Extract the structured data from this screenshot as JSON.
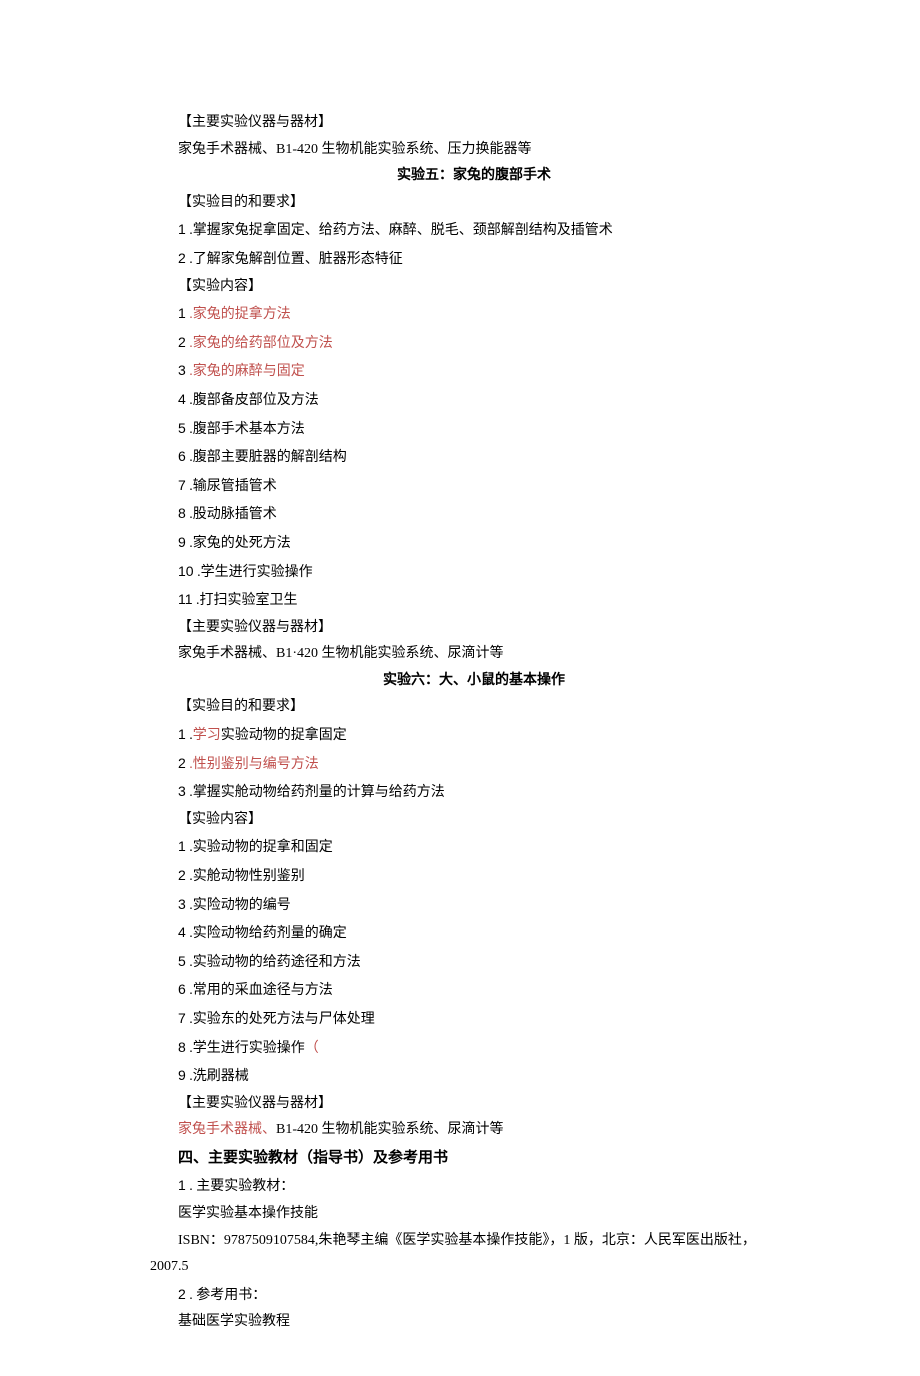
{
  "s0": {
    "h1": "【主要实验仪器与器材】",
    "p1": "家兔手术器械、B1-420 生物机能实验系统、压力换能器等"
  },
  "exp5": {
    "title": "实验五：家兔的腹部手术",
    "aim_h": "【实验目的和要求】",
    "aim1_n": "1",
    "aim1_t": " .掌握家兔捉拿固定、给药方法、麻醉、脱毛、颈部解剖结构及插管术",
    "aim2_n": "2",
    "aim2_t": " .了解家兔解剖位置、脏器形态特征",
    "cont_h": "【实验内容】",
    "c1_n": "1",
    "c1_t": " .家兔的捉拿方法",
    "c2_n": "2",
    "c2_t": "  .家兔的给药部位及方法",
    "c3_n": "3",
    "c3_t": "  .家兔的麻醉与固定",
    "c4_n": "4",
    "c4_t": "  .腹部备皮部位及方法",
    "c5_n": "5",
    "c5_t": "  .腹部手术基本方法",
    "c6_n": "6",
    "c6_t": "  .腹部主要脏器的解剖结构",
    "c7_n": "7",
    "c7_t": "   .输尿管插管术",
    "c8_n": "8",
    "c8_t": "  .股动脉插管术",
    "c9_n": "9",
    "c9_t": "  .家兔的处死方法",
    "c10_n": "10",
    "c10_t": "   .学生进行实验操作",
    "c11_n": "11",
    "c11_t": "  .打扫实验室卫生",
    "inst_h": "【主要实验仪器与器材】",
    "inst_p": "家兔手术器械、B1·420 生物机能实验系统、尿滴计等"
  },
  "exp6": {
    "title": "实验六：大、小鼠的基本操作",
    "aim_h": "【实验目的和要求】",
    "a1_n": "1",
    "a1_pre": " .",
    "a1_red": "学习",
    "a1_rest": "实验动物的捉拿固定",
    "a2_n": "2",
    "a2_t": "  .性别鉴别与编号方法",
    "a3_n": "3",
    "a3_t": "  .掌握实舱动物给药剂量的计算与给药方法",
    "cont_h": "【实验内容】",
    "c1_n": "1",
    "c1_t": "  .实验动物的捉拿和固定",
    "c2_n": "2",
    "c2_t": "  .实舱动物性别鉴别",
    "c3_n": "3",
    "c3_t": "  .实险动物的编号",
    "c4_n": "4",
    "c4_t": "  .实险动物给药剂量的确定",
    "c5_n": "5",
    "c5_t": "  .实验动物的给药途径和方法",
    "c6_n": "6",
    "c6_t": "   .常用的采血途径与方法",
    "c7_n": "7",
    "c7_t": "  .实验东的处死方法与尸体处理",
    "c8_n": "8",
    "c8_t": "  .学生进行实验操作",
    "c8_paren": "（",
    "c9_n": "9",
    "c9_t": "   .洗刷器械",
    "inst_h": "【主要实验仪器与器材】",
    "inst_red": "家兔手术器械、",
    "inst_rest": "B1-420 生物机能实验系统、尿滴计等"
  },
  "sec4": {
    "title": "四、主要实验教材（指导书）及参考用书",
    "p1_n": "1",
    "p1_t": " . 主要实验教材：",
    "p2": "医学实验基本操作技能",
    "p3": "ISBN：9787509107584,朱艳琴主编《医学实验基本操作技能》，1 版，北京：人民军医出版社，",
    "p3b": "2007.5",
    "p4_n": "2",
    "p4_t": "  . 参考用书：",
    "p5": "基础医学实验教程"
  }
}
